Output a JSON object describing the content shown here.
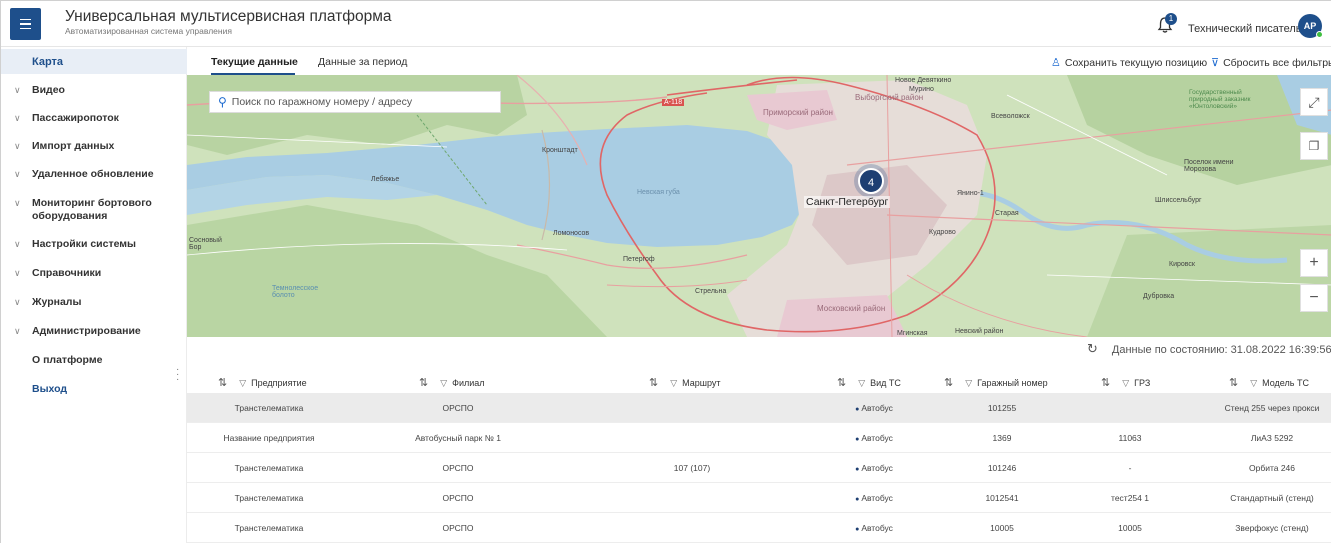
{
  "header": {
    "title": "Универсальная мультисервисная платформа",
    "subtitle": "Автоматизированная система управления",
    "notification_count": "1",
    "user_name": "Технический писатель",
    "avatar_initials": "АР",
    "brand_color": "#1e4f8b"
  },
  "sidebar": {
    "active": "Карта",
    "items": [
      {
        "label": "Видео",
        "expandable": true
      },
      {
        "label": "Пассажиропоток",
        "expandable": true
      },
      {
        "label": "Импорт данных",
        "expandable": true
      },
      {
        "label": "Удаленное обновление",
        "expandable": true
      },
      {
        "label": "Мониторинг бортового оборудования",
        "expandable": true
      },
      {
        "label": "Настройки системы",
        "expandable": true
      },
      {
        "label": "Справочники",
        "expandable": true
      },
      {
        "label": "Журналы",
        "expandable": true
      },
      {
        "label": "Администрирование",
        "expandable": true
      },
      {
        "label": "О платформе",
        "expandable": false
      },
      {
        "label": "Выход",
        "expandable": false
      }
    ]
  },
  "tabs": [
    {
      "label": "Текущие данные",
      "active": true
    },
    {
      "label": "Данные за период",
      "active": false
    }
  ],
  "toolbar": {
    "save_position": "Сохранить текущую позицию",
    "reset_filters": "Сбросить все фильтры"
  },
  "map": {
    "search_placeholder": "Поиск по гаражному номеру / адресу",
    "cluster_count": "4",
    "city": "Санкт-Петербург",
    "labels": [
      "Новое Девяткино",
      "Мурино",
      "Выборгский район",
      "Приморский район",
      "Всеволожск",
      "Кронштадт",
      "Лебяжье",
      "Невская губа",
      "Ломоносов",
      "Петергоф",
      "Стрельна",
      "Сосновый Бор",
      "Янино-1",
      "Старая",
      "Кудрово",
      "Шлиссельбург",
      "Кировск",
      "Дубровка",
      "Поселок имени Морозова",
      "Московский район",
      "Невский район",
      "Мгинская",
      "А-118",
      "Государственный природный заказник «Юнтоловский»",
      "Темнолесское болото"
    ]
  },
  "status": {
    "text": "Данные по состоянию: 31.08.2022 16:39:56"
  },
  "table": {
    "columns": [
      "Предприятие",
      "Филиал",
      "Маршрут",
      "Вид ТС",
      "Гаражный номер",
      "ГРЗ",
      "Модель ТС"
    ],
    "rows": [
      {
        "enterprise": "Транстелематика",
        "branch": "ОРСПО",
        "route": "",
        "type": "Автобус",
        "garage": "101255",
        "plate": "",
        "model": "Стенд 255 через прокси",
        "selected": true
      },
      {
        "enterprise": "Название предприятия",
        "branch": "Автобусный парк № 1",
        "route": "",
        "type": "Автобус",
        "garage": "1369",
        "plate": "11063",
        "model": "ЛиАЗ 5292",
        "selected": false
      },
      {
        "enterprise": "Транстелематика",
        "branch": "ОРСПО",
        "route": "107 (107)",
        "type": "Автобус",
        "garage": "101246",
        "plate": "-",
        "model": "Орбита 246",
        "selected": false
      },
      {
        "enterprise": "Транстелематика",
        "branch": "ОРСПО",
        "route": "",
        "type": "Автобус",
        "garage": "1012541",
        "plate": "тест254 1",
        "model": "Стандартный (стенд)",
        "selected": false
      },
      {
        "enterprise": "Транстелематика",
        "branch": "ОРСПО",
        "route": "",
        "type": "Автобус",
        "garage": "10005",
        "plate": "10005",
        "model": "Зверфокус (стенд)",
        "selected": false
      }
    ]
  }
}
